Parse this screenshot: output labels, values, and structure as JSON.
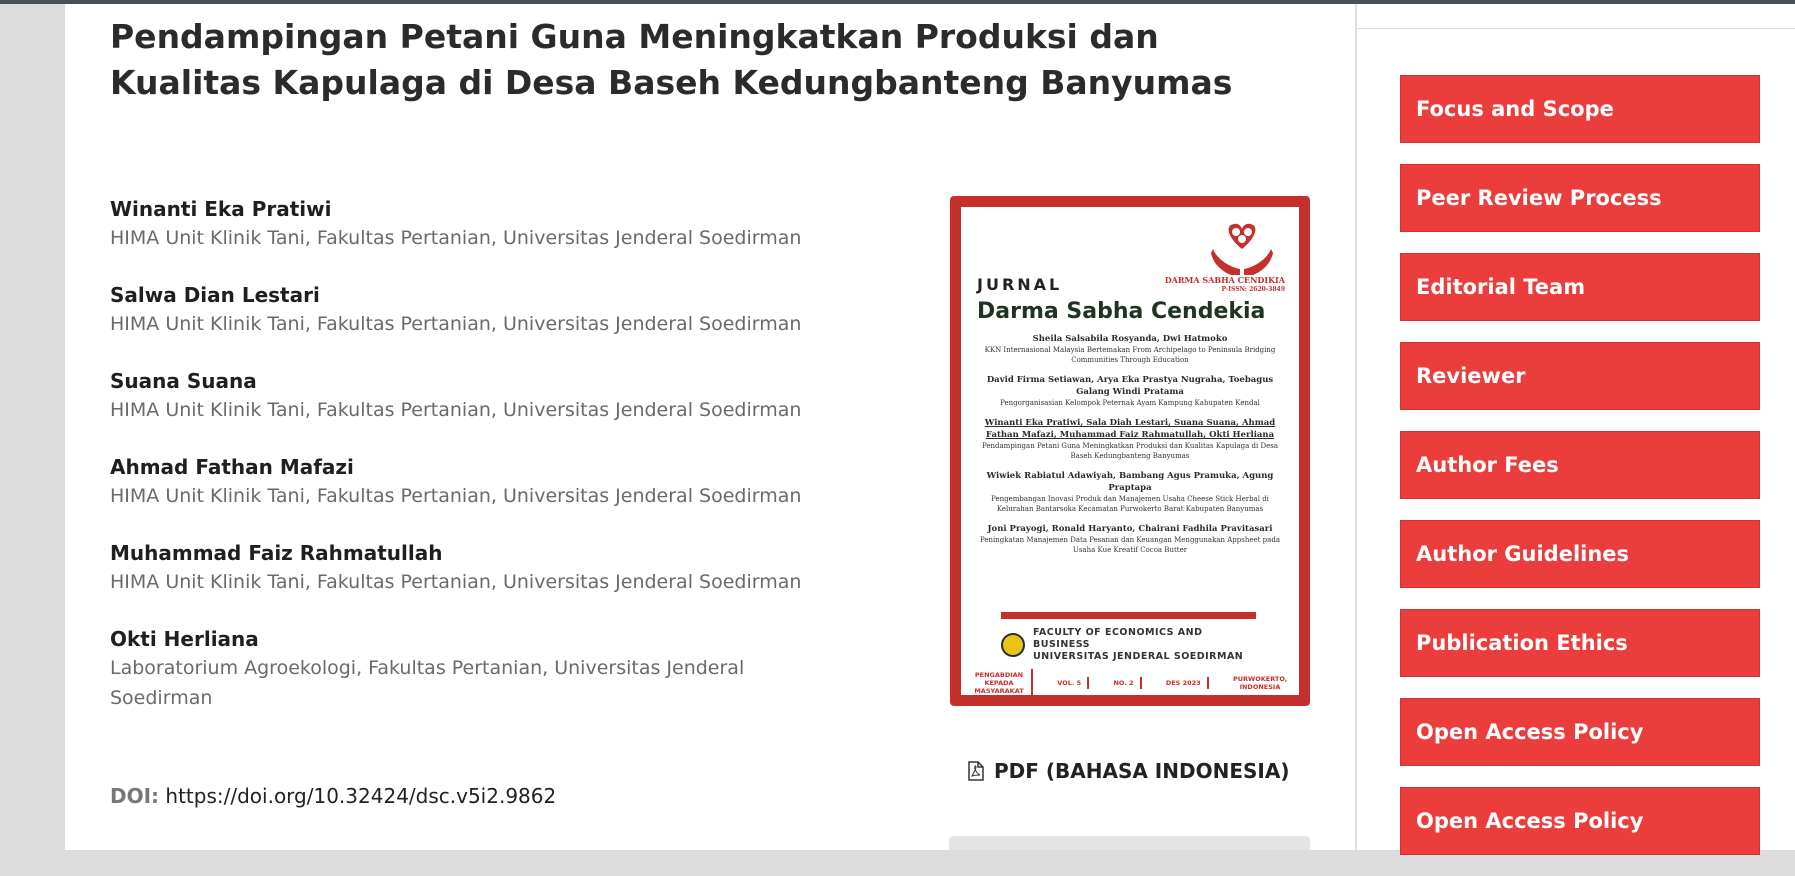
{
  "article": {
    "title": "Pendampingan Petani Guna Meningkatkan Produksi dan Kualitas Kapulaga di Desa Baseh Kedungbanteng Banyumas",
    "authors": [
      {
        "name": "Winanti Eka Pratiwi",
        "affiliation": "HIMA Unit Klinik Tani, Fakultas Pertanian, Universitas Jenderal Soedirman"
      },
      {
        "name": "Salwa Dian Lestari",
        "affiliation": "HIMA Unit Klinik Tani, Fakultas Pertanian, Universitas Jenderal Soedirman"
      },
      {
        "name": "Suana Suana",
        "affiliation": "HIMA Unit Klinik Tani, Fakultas Pertanian, Universitas Jenderal Soedirman"
      },
      {
        "name": "Ahmad Fathan Mafazi",
        "affiliation": "HIMA Unit Klinik Tani, Fakultas Pertanian, Universitas Jenderal Soedirman"
      },
      {
        "name": "Muhammad Faiz Rahmatullah",
        "affiliation": "HIMA Unit Klinik Tani, Fakultas Pertanian, Universitas Jenderal Soedirman"
      },
      {
        "name": "Okti Herliana",
        "affiliation": "Laboratorium Agroekologi, Fakultas Pertanian, Universitas Jenderal Soedirman"
      }
    ],
    "doi_label": "DOI:",
    "doi_url": "https://doi.org/10.32424/dsc.v5i2.9862"
  },
  "cover": {
    "jurnal": "JURNAL",
    "name": "Darma Sabha Cendekia",
    "brand": "DARMA SABHA CENDIKIA",
    "issn": "P-ISSN: 2620-3849",
    "entries": [
      {
        "authors": "Sheila Salsabila Rosyanda, Dwi Hatmoko",
        "title": "KKN Internasional Malaysia Bertemakan From Archipelago to Peninsula Bridging Communities Through Education"
      },
      {
        "authors": "David Firma Setiawan, Arya Eka Prastya Nugraha, Toebagus Galang Windi Pratama",
        "title": "Pengorganisasian Kelompok Peternak Ayam Kampung Kabupaten Kendal"
      },
      {
        "authors": "Winanti Eka Pratiwi, Sala Diah Lestari, Suana Suana, Ahmad Fathan Mafazi, Muhammad Faiz Rahmatullah, Okti Herliana",
        "title": "Pendampingan Petani Guna Meningkatkan Produksi dan Kualitas Kapulaga di Desa Baseh Kedungbanteng Banyumas"
      },
      {
        "authors": "Wiwiek Rabiatul Adawiyah, Bambang Agus Pramuka, Agung Praptapa",
        "title": "Pengembangan Inovasi Produk dan Manajemen Usaha Cheese Stick Herbal di Kelurahan Bantarsoka Kecamatan Purwokerto Barat Kabupaten Banyumas"
      },
      {
        "authors": "Joni Prayogi, Ronald Haryanto, Chairani Fadhila Pravitasari",
        "title": "Peningkatan Manajemen Data Pesanan dan Keuangan Menggunakan Appsheet pada Usaha Kue Kreatif Cocoa Butter"
      }
    ],
    "faculty_line1": "FACULTY OF ECONOMICS AND BUSINESS",
    "faculty_line2": "UNIVERSITAS JENDERAL SOEDIRMAN",
    "footer": [
      "PENGABDIAN KEPADA MASYARAKAT",
      "VOL. 5",
      "NO. 2",
      "DES 2023",
      "PURWOKERTO, INDONESIA"
    ],
    "frame_color": "#c4302b"
  },
  "pdf": {
    "label": "PDF (BAHASA INDONESIA)",
    "icon": "file-pdf-icon"
  },
  "sidebar": {
    "accent": "#ec3d3d",
    "items": [
      {
        "label": "Focus and Scope"
      },
      {
        "label": "Peer Review Process"
      },
      {
        "label": "Editorial Team"
      },
      {
        "label": "Reviewer"
      },
      {
        "label": "Author Fees"
      },
      {
        "label": "Author Guidelines"
      },
      {
        "label": "Publication Ethics"
      },
      {
        "label": "Open Access Policy"
      },
      {
        "label": "Open Access Policy"
      }
    ]
  }
}
